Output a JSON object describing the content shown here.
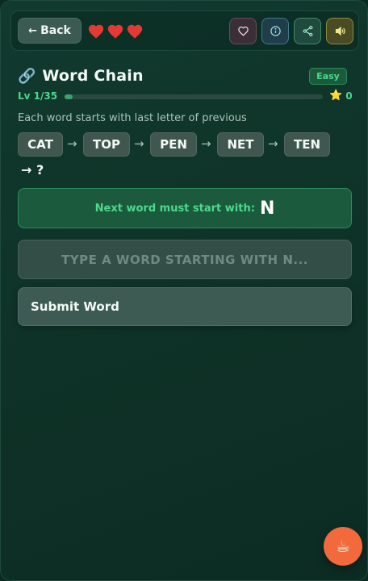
{
  "topbar": {
    "back_label": "Back",
    "back_arrow": "←",
    "lives": 3,
    "heart_color": "#e53935",
    "icons": [
      "heart-outline-icon",
      "info-icon",
      "share-icon",
      "sound-icon"
    ]
  },
  "game": {
    "title_icon": "🔗",
    "title": "Word Chain",
    "difficulty": "Easy",
    "level_label": "Lv 1/35",
    "level_progress": 0.03,
    "star_icon": "⭐",
    "stars": "0",
    "instructions": "Each word starts with last letter of previous",
    "chain": [
      "CAT",
      "TOP",
      "PEN",
      "NET",
      "TEN"
    ],
    "arrow": "→",
    "chain_end": "→ ?",
    "hint_label": "Next word must start with:",
    "hint_letter": "N",
    "input_placeholder": "TYPE A WORD STARTING WITH N...",
    "input_value": "",
    "submit_label": "Submit Word"
  },
  "fab": {
    "icon": "☕",
    "color": "#f26a3b"
  }
}
